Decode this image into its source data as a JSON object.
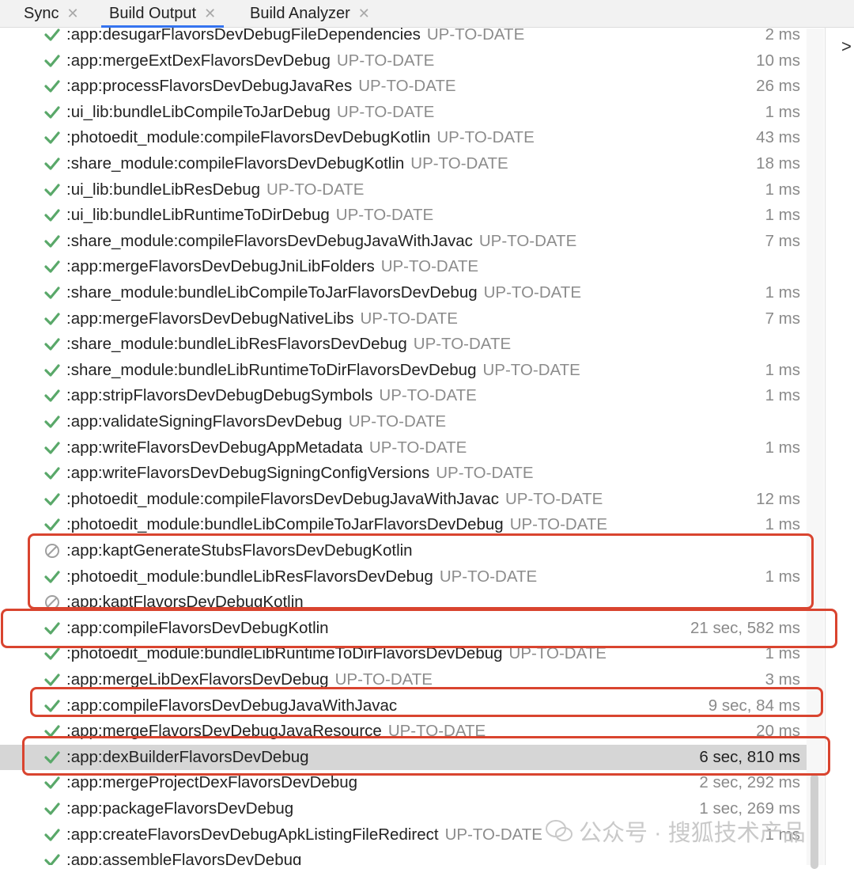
{
  "tabs": [
    {
      "label": "Sync"
    },
    {
      "label": "Build Output"
    },
    {
      "label": "Build Analyzer"
    }
  ],
  "side_panel": {
    "arrow": ">"
  },
  "tasks": [
    {
      "status": "success",
      "name": ":app:desugarFlavorsDevDebugFileDependencies",
      "uptodate": "UP-TO-DATE",
      "time": "2 ms"
    },
    {
      "status": "success",
      "name": ":app:mergeExtDexFlavorsDevDebug",
      "uptodate": "UP-TO-DATE",
      "time": "10 ms"
    },
    {
      "status": "success",
      "name": ":app:processFlavorsDevDebugJavaRes",
      "uptodate": "UP-TO-DATE",
      "time": "26 ms"
    },
    {
      "status": "success",
      "name": ":ui_lib:bundleLibCompileToJarDebug",
      "uptodate": "UP-TO-DATE",
      "time": "1 ms"
    },
    {
      "status": "success",
      "name": ":photoedit_module:compileFlavorsDevDebugKotlin",
      "uptodate": "UP-TO-DATE",
      "time": "43 ms"
    },
    {
      "status": "success",
      "name": ":share_module:compileFlavorsDevDebugKotlin",
      "uptodate": "UP-TO-DATE",
      "time": "18 ms"
    },
    {
      "status": "success",
      "name": ":ui_lib:bundleLibResDebug",
      "uptodate": "UP-TO-DATE",
      "time": "1 ms"
    },
    {
      "status": "success",
      "name": ":ui_lib:bundleLibRuntimeToDirDebug",
      "uptodate": "UP-TO-DATE",
      "time": "1 ms"
    },
    {
      "status": "success",
      "name": ":share_module:compileFlavorsDevDebugJavaWithJavac",
      "uptodate": "UP-TO-DATE",
      "time": "7 ms"
    },
    {
      "status": "success",
      "name": ":app:mergeFlavorsDevDebugJniLibFolders",
      "uptodate": "UP-TO-DATE",
      "time": ""
    },
    {
      "status": "success",
      "name": ":share_module:bundleLibCompileToJarFlavorsDevDebug",
      "uptodate": "UP-TO-DATE",
      "time": "1 ms"
    },
    {
      "status": "success",
      "name": ":app:mergeFlavorsDevDebugNativeLibs",
      "uptodate": "UP-TO-DATE",
      "time": "7 ms"
    },
    {
      "status": "success",
      "name": ":share_module:bundleLibResFlavorsDevDebug",
      "uptodate": "UP-TO-DATE",
      "time": ""
    },
    {
      "status": "success",
      "name": ":share_module:bundleLibRuntimeToDirFlavorsDevDebug",
      "uptodate": "UP-TO-DATE",
      "time": "1 ms"
    },
    {
      "status": "success",
      "name": ":app:stripFlavorsDevDebugDebugSymbols",
      "uptodate": "UP-TO-DATE",
      "time": "1 ms"
    },
    {
      "status": "success",
      "name": ":app:validateSigningFlavorsDevDebug",
      "uptodate": "UP-TO-DATE",
      "time": ""
    },
    {
      "status": "success",
      "name": ":app:writeFlavorsDevDebugAppMetadata",
      "uptodate": "UP-TO-DATE",
      "time": "1 ms"
    },
    {
      "status": "success",
      "name": ":app:writeFlavorsDevDebugSigningConfigVersions",
      "uptodate": "UP-TO-DATE",
      "time": ""
    },
    {
      "status": "success",
      "name": ":photoedit_module:compileFlavorsDevDebugJavaWithJavac",
      "uptodate": "UP-TO-DATE",
      "time": "12 ms"
    },
    {
      "status": "success",
      "name": ":photoedit_module:bundleLibCompileToJarFlavorsDevDebug",
      "uptodate": "UP-TO-DATE",
      "time": "1 ms"
    },
    {
      "status": "skipped",
      "name": ":app:kaptGenerateStubsFlavorsDevDebugKotlin",
      "uptodate": "",
      "time": ""
    },
    {
      "status": "success",
      "name": ":photoedit_module:bundleLibResFlavorsDevDebug",
      "uptodate": "UP-TO-DATE",
      "time": "1 ms"
    },
    {
      "status": "skipped",
      "name": ":app:kaptFlavorsDevDebugKotlin",
      "uptodate": "",
      "time": ""
    },
    {
      "status": "success",
      "name": ":app:compileFlavorsDevDebugKotlin",
      "uptodate": "",
      "time": "21 sec, 582 ms"
    },
    {
      "status": "success",
      "name": ":photoedit_module:bundleLibRuntimeToDirFlavorsDevDebug",
      "uptodate": "UP-TO-DATE",
      "time": "1 ms"
    },
    {
      "status": "success",
      "name": ":app:mergeLibDexFlavorsDevDebug",
      "uptodate": "UP-TO-DATE",
      "time": "3 ms"
    },
    {
      "status": "success",
      "name": ":app:compileFlavorsDevDebugJavaWithJavac",
      "uptodate": "",
      "time": "9 sec, 84 ms"
    },
    {
      "status": "success",
      "name": ":app:mergeFlavorsDevDebugJavaResource",
      "uptodate": "UP-TO-DATE",
      "time": "20 ms"
    },
    {
      "status": "success",
      "name": ":app:dexBuilderFlavorsDevDebug",
      "uptodate": "",
      "time": "6 sec, 810 ms",
      "selected": true
    },
    {
      "status": "success",
      "name": ":app:mergeProjectDexFlavorsDevDebug",
      "uptodate": "",
      "time": "2 sec, 292 ms"
    },
    {
      "status": "success",
      "name": ":app:packageFlavorsDevDebug",
      "uptodate": "",
      "time": "1 sec, 269 ms"
    },
    {
      "status": "success",
      "name": ":app:createFlavorsDevDebugApkListingFileRedirect",
      "uptodate": "UP-TO-DATE",
      "time": "1 ms"
    },
    {
      "status": "success",
      "name": ":app:assembleFlavorsDevDebug",
      "uptodate": "",
      "time": ""
    }
  ],
  "watermark": {
    "text": "公众号 · 搜狐技术产品"
  },
  "colors": {
    "success": "#59a869",
    "skipped": "#a0a0a0",
    "highlight": "#d9442f",
    "accent": "#3574f0"
  }
}
